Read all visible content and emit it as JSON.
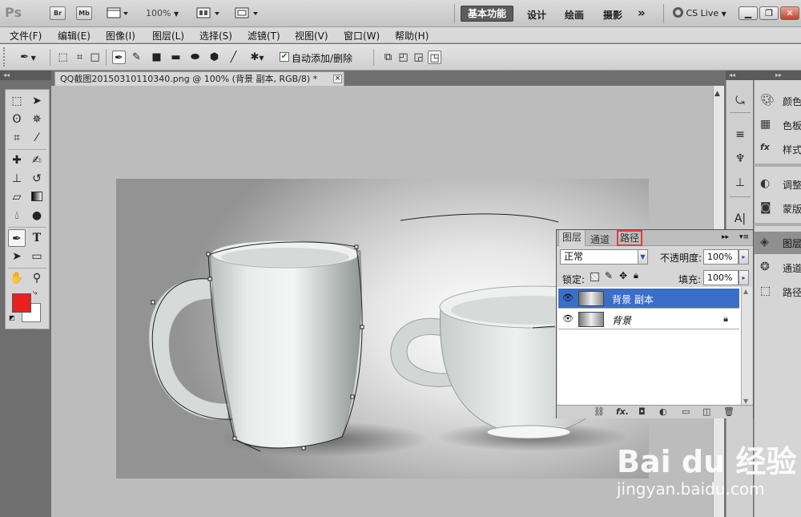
{
  "appbar": {
    "logo": "Ps",
    "br": "Br",
    "mb": "Mb",
    "zoom": "100%",
    "workspaces": [
      "基本功能",
      "设计",
      "绘画",
      "摄影"
    ],
    "more": "»",
    "cslive": "CS Live"
  },
  "menu": [
    "文件(F)",
    "编辑(E)",
    "图像(I)",
    "图层(L)",
    "选择(S)",
    "滤镜(T)",
    "视图(V)",
    "窗口(W)",
    "帮助(H)"
  ],
  "options": {
    "auto_add_delete_label": "自动添加/删除",
    "auto_add_delete_checked": true
  },
  "document": {
    "tab_title": "QQ截图20150310110340.png @ 100% (背景 副本, RGB/8) *",
    "close": "×"
  },
  "dock": {
    "group1": [
      {
        "icon": "palette-icon",
        "label": "颜色"
      },
      {
        "icon": "swatches-icon",
        "label": "色板"
      },
      {
        "icon": "fx-icon",
        "label": "样式"
      }
    ],
    "group2": [
      {
        "icon": "adjustments-icon",
        "label": "调整"
      },
      {
        "icon": "masks-icon",
        "label": "蒙版"
      }
    ],
    "group3": [
      {
        "icon": "layers-icon",
        "label": "图层",
        "selected": true
      },
      {
        "icon": "channels-icon",
        "label": "通道"
      },
      {
        "icon": "paths-icon",
        "label": "路径"
      }
    ]
  },
  "layers_panel": {
    "tabs": [
      "图层",
      "通道",
      "路径"
    ],
    "blend_mode": "正常",
    "opacity_label": "不透明度:",
    "opacity": "100%",
    "lock_label": "锁定:",
    "fill_label": "填充:",
    "fill": "100%",
    "layers": [
      {
        "name": "背景 副本",
        "selected": true,
        "locked": false
      },
      {
        "name": "背景",
        "selected": false,
        "locked": true
      }
    ]
  },
  "watermark": {
    "logo": "Bai du 经验",
    "url": "jingyan.baidu.com"
  }
}
